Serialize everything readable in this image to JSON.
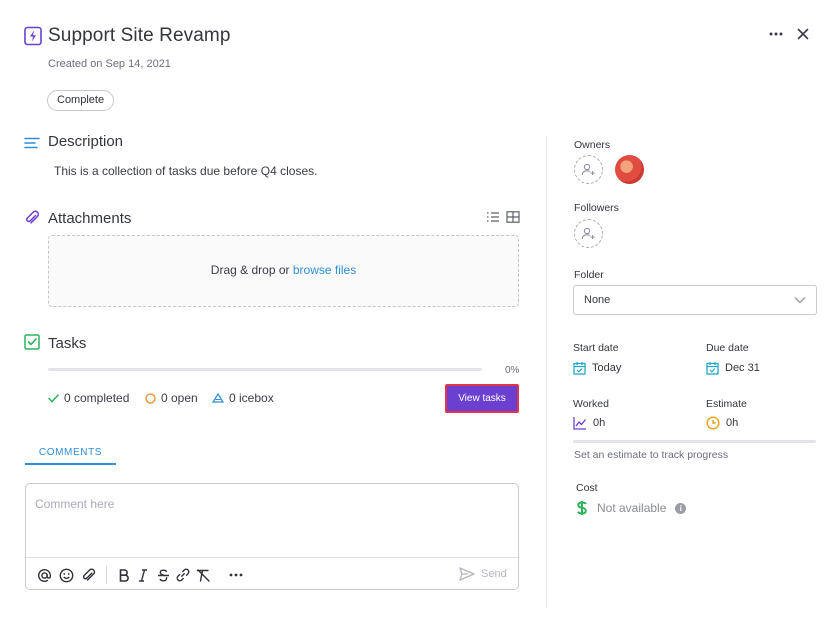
{
  "header": {
    "title": "Support Site Revamp",
    "created": "Created on Sep 14, 2021",
    "status": "Complete"
  },
  "description": {
    "title": "Description",
    "text": "This is a collection of tasks due before Q4 closes."
  },
  "attachments": {
    "title": "Attachments",
    "drop_text": "Drag & drop or ",
    "browse_link": "browse files"
  },
  "tasks": {
    "title": "Tasks",
    "progress_fraction": 0,
    "progress_label": "0%",
    "completed": "0 completed",
    "open": "0 open",
    "icebox": "0 icebox",
    "view_button": "View tasks"
  },
  "comments": {
    "tab_label": "COMMENTS",
    "placeholder": "Comment here",
    "send_label": "Send"
  },
  "sidebar": {
    "owners_label": "Owners",
    "followers_label": "Followers",
    "folder_label": "Folder",
    "folder_value": "None",
    "start_date_label": "Start date",
    "start_date_value": "Today",
    "due_date_label": "Due date",
    "due_date_value": "Dec 31",
    "worked_label": "Worked",
    "worked_value": "0h",
    "estimate_label": "Estimate",
    "estimate_value": "0h",
    "estimate_hint": "Set an estimate to track progress",
    "cost_label": "Cost",
    "cost_value": "Not available"
  },
  "colors": {
    "accent": "#6b3fd0",
    "link": "#2f8fd8",
    "highlight_border": "#e0344a",
    "success": "#2bb55a",
    "open": "#f08a24",
    "icebox": "#2f8fd8",
    "calendar": "#23a9c9",
    "estimate": "#f0a020"
  },
  "icons": [
    "lightning-icon",
    "more-icon",
    "close-icon",
    "list-lines-icon",
    "paperclip-icon",
    "list-view-icon",
    "grid-view-icon",
    "checkbox-icon",
    "check-icon",
    "circle-icon",
    "triangle-icon",
    "at-icon",
    "emoji-icon",
    "bold-icon",
    "italic-icon",
    "strikethrough-icon",
    "link-icon",
    "clear-format-icon",
    "send-icon",
    "add-person-icon",
    "calendar-icon",
    "chart-icon",
    "clock-icon",
    "dollar-icon",
    "info-icon",
    "chevron-down-icon"
  ]
}
